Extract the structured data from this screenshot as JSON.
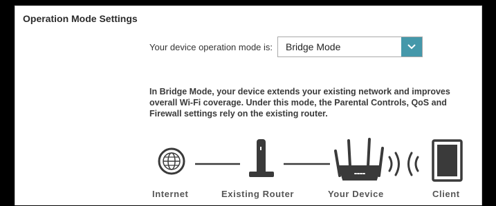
{
  "section": {
    "title": "Operation Mode Settings"
  },
  "mode": {
    "label": "Your device operation mode is:",
    "selected": "Bridge Mode"
  },
  "description": "In Bridge Mode, your device extends your existing network and improves overall Wi-Fi coverage. Under this mode, the Parental Controls, QoS and Firewall settings rely on the existing router.",
  "diagram": {
    "internet": "Internet",
    "existing_router": "Existing Router",
    "your_device": "Your Device",
    "client": "Client"
  },
  "colors": {
    "accent": "#4598aa",
    "icon": "#3a3a3a"
  }
}
